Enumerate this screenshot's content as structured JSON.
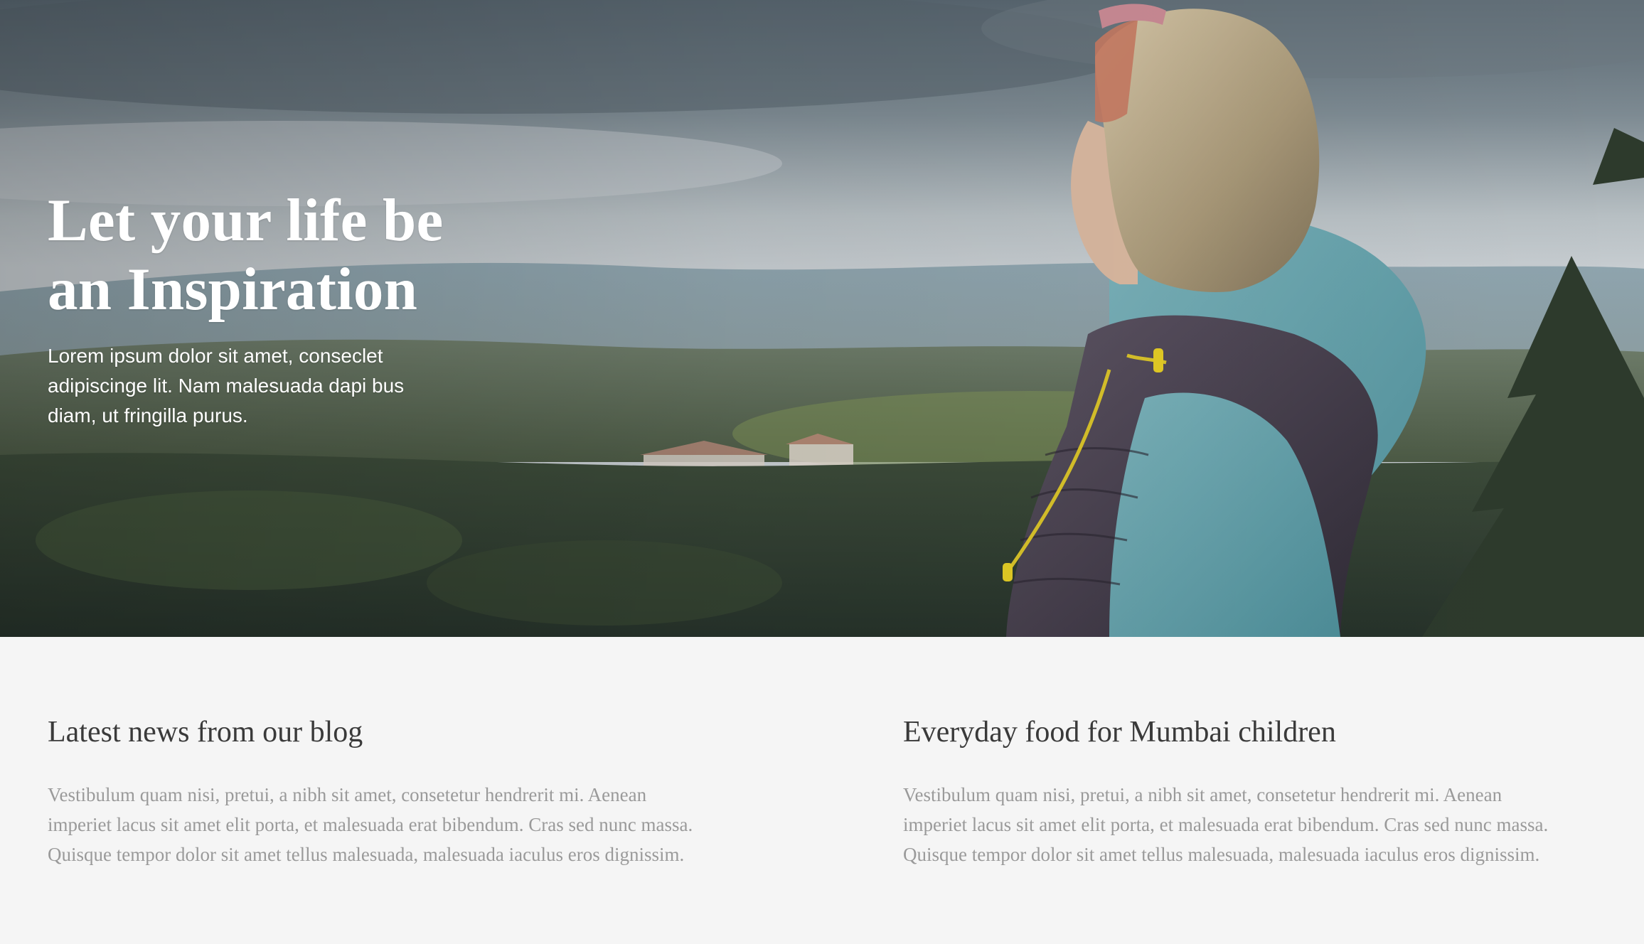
{
  "hero": {
    "title_line1": "Let your life be",
    "title_line2": "an Inspiration",
    "text_line1": "Lorem ipsum dolor sit amet, conseclet",
    "text_line2": "adipiscinge lit. Nam malesuada dapi bus",
    "text_line3": "diam, ut fringilla purus.",
    "image": "woman-overlooking-forest-landscape"
  },
  "sections": [
    {
      "title": "Latest news from our blog",
      "line1": "Vestibulum quam nisi, pretui, a nibh sit amet, consetetur hendrerit mi. Aenean",
      "line2": "imperiet lacus sit amet elit porta, et malesuada erat bibendum. Cras sed nunc massa.",
      "line3": "Quisque tempor dolor sit amet tellus malesuada, malesuada iaculus eros dignissim."
    },
    {
      "title": "Everyday food for Mumbai children",
      "line1": "Vestibulum quam nisi, pretui, a nibh sit amet, consetetur hendrerit mi. Aenean",
      "line2": "imperiet lacus sit amet elit porta, et malesuada erat bibendum. Cras sed nunc massa.",
      "line3": "Quisque tempor dolor sit amet tellus malesuada, malesuada iaculus eros dignissim."
    }
  ],
  "colors": {
    "page_background": "#f5f5f5",
    "heading": "#3a3a3a",
    "body_text": "#9a9a9a",
    "hero_text": "#ffffff"
  }
}
